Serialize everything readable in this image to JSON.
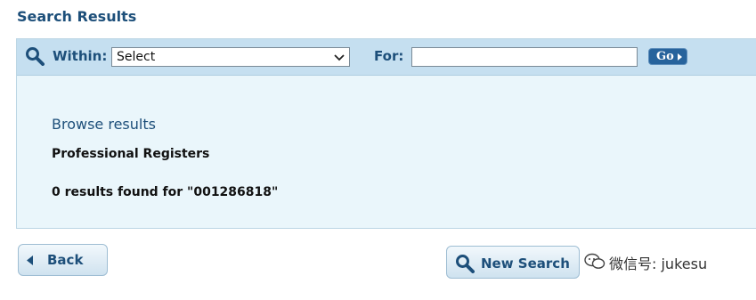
{
  "page": {
    "title": "Search Results"
  },
  "search_bar": {
    "within_label": "Within:",
    "within_select_value": "Select",
    "for_label": "For:",
    "for_input_value": "",
    "go_label": "Go"
  },
  "results": {
    "heading": "Browse results",
    "register_name": "Professional Registers",
    "summary": "0 results found for \"001286818\""
  },
  "actions": {
    "back_label": "Back",
    "new_search_label": "New Search"
  },
  "wechat": {
    "label": "微信号: jukesu"
  },
  "icons": [
    "search-icon",
    "chevron-down-icon",
    "caret-right-icon",
    "caret-left-icon",
    "wechat-icon"
  ],
  "colors": {
    "heading": "#1d4f7a",
    "panel_bg": "#eaf6fb",
    "bar_bg": "#c5dff0",
    "go_button": "#27639c"
  }
}
